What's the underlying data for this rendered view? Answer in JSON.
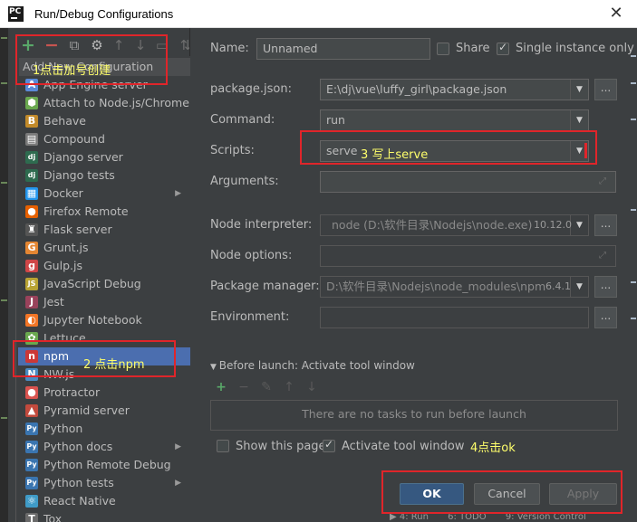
{
  "window": {
    "title": "Run/Debug Configurations",
    "logo_text": "PC",
    "close": "✕"
  },
  "toolbar": {
    "add": "+",
    "remove": "−",
    "copy": "⧉",
    "settings": "⚙",
    "up": "↑",
    "down": "↓",
    "folder": "▭",
    "sort": "⇅"
  },
  "popup": {
    "header": "Add New Configuration",
    "items": [
      {
        "label": "App Engine server",
        "icon": "app-engine-icon",
        "glyph": "A",
        "color": "#5b8ad8",
        "arrow": false
      },
      {
        "label": "Attach to Node.js/Chrome",
        "icon": "nodejs-icon",
        "glyph": "⬢",
        "color": "#6aa84f",
        "arrow": false
      },
      {
        "label": "Behave",
        "icon": "behave-icon",
        "glyph": "B",
        "color": "#c28a2a",
        "arrow": false
      },
      {
        "label": "Compound",
        "icon": "compound-icon",
        "glyph": "▤",
        "color": "#7a7a7a",
        "arrow": false
      },
      {
        "label": "Django server",
        "icon": "django-icon",
        "glyph": "dj",
        "color": "#2e6b4f",
        "arrow": false
      },
      {
        "label": "Django tests",
        "icon": "django-tests-icon",
        "glyph": "dj",
        "color": "#2e6b4f",
        "arrow": false
      },
      {
        "label": "Docker",
        "icon": "docker-icon",
        "glyph": "▦",
        "color": "#2496ed",
        "arrow": true
      },
      {
        "label": "Firefox Remote",
        "icon": "firefox-icon",
        "glyph": "●",
        "color": "#e66000",
        "arrow": false
      },
      {
        "label": "Flask server",
        "icon": "flask-icon",
        "glyph": "♜",
        "color": "#555555",
        "arrow": false
      },
      {
        "label": "Grunt.js",
        "icon": "grunt-icon",
        "glyph": "G",
        "color": "#e48632",
        "arrow": false
      },
      {
        "label": "Gulp.js",
        "icon": "gulp-icon",
        "glyph": "g",
        "color": "#cf4647",
        "arrow": false
      },
      {
        "label": "JavaScript Debug",
        "icon": "js-debug-icon",
        "glyph": "JS",
        "color": "#b8a333",
        "arrow": false
      },
      {
        "label": "Jest",
        "icon": "jest-icon",
        "glyph": "J",
        "color": "#99425b",
        "arrow": false
      },
      {
        "label": "Jupyter Notebook",
        "icon": "jupyter-icon",
        "glyph": "◐",
        "color": "#f37626",
        "arrow": false
      },
      {
        "label": "Lettuce",
        "icon": "lettuce-icon",
        "glyph": "✿",
        "color": "#6aa84f",
        "arrow": false
      },
      {
        "label": "npm",
        "icon": "npm-icon",
        "glyph": "n",
        "color": "#cb3837",
        "arrow": false,
        "selected": true
      },
      {
        "label": "NW.js",
        "icon": "nwjs-icon",
        "glyph": "N",
        "color": "#4a8bc2",
        "arrow": false
      },
      {
        "label": "Protractor",
        "icon": "protractor-icon",
        "glyph": "●",
        "color": "#d9534f",
        "arrow": false
      },
      {
        "label": "Pyramid server",
        "icon": "pyramid-icon",
        "glyph": "▲",
        "color": "#c24a3d",
        "arrow": false
      },
      {
        "label": "Python",
        "icon": "python-icon",
        "glyph": "Py",
        "color": "#3a75b0",
        "arrow": false
      },
      {
        "label": "Python docs",
        "icon": "python-docs-icon",
        "glyph": "Py",
        "color": "#3a75b0",
        "arrow": true
      },
      {
        "label": "Python Remote Debug",
        "icon": "python-remote-icon",
        "glyph": "Py",
        "color": "#3a75b0",
        "arrow": false
      },
      {
        "label": "Python tests",
        "icon": "python-tests-icon",
        "glyph": "Py",
        "color": "#3a75b0",
        "arrow": true
      },
      {
        "label": "React Native",
        "icon": "react-icon",
        "glyph": "⚛",
        "color": "#3f9bc7",
        "arrow": false
      },
      {
        "label": "Tox",
        "icon": "tox-icon",
        "glyph": "T",
        "color": "#6a6a6a",
        "arrow": false
      }
    ]
  },
  "form": {
    "name_label": "Name:",
    "name_value": "Unnamed",
    "share_label": "Share",
    "single_instance_label": "Single instance only",
    "package_json_label": "package.json:",
    "package_json_value": "E:\\dj\\vue\\luffy_girl\\package.json",
    "command_label": "Command:",
    "command_value": "run",
    "scripts_label": "Scripts:",
    "scripts_value": "serve",
    "arguments_label": "Arguments:",
    "node_interpreter_label": "Node interpreter:",
    "node_interpreter_value": "node (D:\\软件目录\\Nodejs\\node.exe)",
    "node_version": "10.12.0",
    "node_options_label": "Node options:",
    "package_manager_label": "Package manager:",
    "package_manager_value": "D:\\软件目录\\Nodejs\\node_modules\\npm",
    "package_manager_version": "6.4.1",
    "environment_label": "Environment:",
    "ellipsis": "...",
    "dropdown_arrow": "▼"
  },
  "before_launch": {
    "title": "Before launch: Activate tool window",
    "empty_text": "There are no tasks to run before launch",
    "show_page_label": "Show this page",
    "activate_label": "Activate tool window"
  },
  "buttons": {
    "ok": "OK",
    "cancel": "Cancel",
    "apply": "Apply"
  },
  "annotations": {
    "step1": "1点击加号创建",
    "step2": "2 点击npm",
    "step3": "3 写上serve",
    "step4": "4点击ok",
    "color": "#e0252a"
  },
  "bottom_bar": {
    "run": "▶ 4: Run",
    "todo": "6: TODO",
    "version_control": "9: Version Control"
  }
}
